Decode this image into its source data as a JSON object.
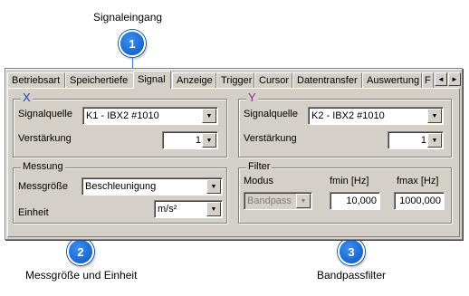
{
  "callouts": [
    {
      "number": "1",
      "text": "Signaleingang"
    },
    {
      "number": "2",
      "text": "Messgröße und Einheit"
    },
    {
      "number": "3",
      "text": "Bandpassfilter"
    }
  ],
  "tabs": [
    {
      "label": "Betriebsart"
    },
    {
      "label": "Speichertiefe"
    },
    {
      "label": "Signal",
      "active": true
    },
    {
      "label": "Anzeige"
    },
    {
      "label": "Trigger"
    },
    {
      "label": "Cursor"
    },
    {
      "label": "Datentransfer"
    },
    {
      "label": "Auswertung"
    },
    {
      "label": "F"
    }
  ],
  "tab_scroll": {
    "left": "◄",
    "right": "►"
  },
  "channel_x": {
    "legend": "X",
    "signalquelle_label": "Signalquelle",
    "signalquelle_value": "K1 - IBX2 #1010",
    "verstaerkung_label": "Verstärkung",
    "verstaerkung_value": "1"
  },
  "channel_y": {
    "legend": "Y",
    "signalquelle_label": "Signalquelle",
    "signalquelle_value": "K2 - IBX2 #1010",
    "verstaerkung_label": "Verstärkung",
    "verstaerkung_value": "1"
  },
  "messung": {
    "legend": "Messung",
    "messgroesse_label": "Messgröße",
    "messgroesse_value": "Beschleunigung",
    "einheit_label": "Einheit",
    "einheit_value": "m/s²"
  },
  "filter": {
    "legend": "Filter",
    "modus_label": "Modus",
    "fmin_label": "fmin [Hz]",
    "fmax_label": "fmax [Hz]",
    "modus_value": "Bandpass",
    "fmin_value": "10,000",
    "fmax_value": "1000,000"
  },
  "icons": {
    "dropdown": "▼"
  }
}
